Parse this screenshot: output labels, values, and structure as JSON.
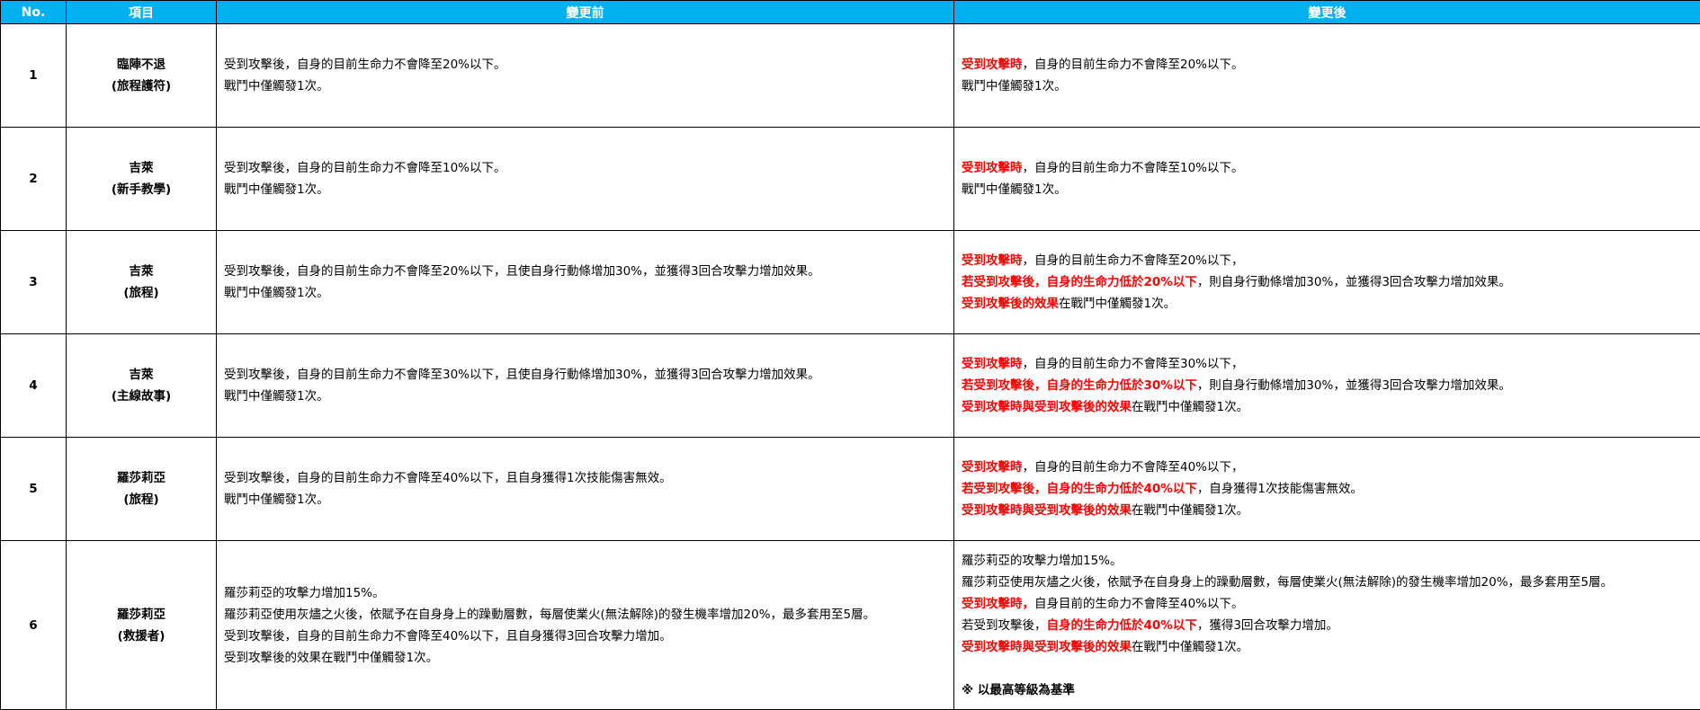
{
  "headers": {
    "no": "No.",
    "item": "項目",
    "before": "變更前",
    "after": "變更後"
  },
  "rows": [
    {
      "no": "1",
      "item": [
        "臨陣不退",
        "(旅程護符)"
      ],
      "before": [
        [
          {
            "t": "受到攻擊後，自身的目前生命力不會降至20%以下。",
            "r": false
          }
        ],
        [
          {
            "t": "戰鬥中僅觸發1次。",
            "r": false
          }
        ]
      ],
      "after": [
        [
          {
            "t": "受到攻擊時",
            "r": true
          },
          {
            "t": "，自身的目前生命力不會降至20%以下。",
            "r": false
          }
        ],
        [
          {
            "t": "戰鬥中僅觸發1次。",
            "r": false
          }
        ]
      ]
    },
    {
      "no": "2",
      "item": [
        "吉萊",
        "(新手教學)"
      ],
      "before": [
        [
          {
            "t": "受到攻擊後，自身的目前生命力不會降至10%以下。",
            "r": false
          }
        ],
        [
          {
            "t": "戰鬥中僅觸發1次。",
            "r": false
          }
        ]
      ],
      "after": [
        [
          {
            "t": "受到攻擊時",
            "r": true
          },
          {
            "t": "，自身的目前生命力不會降至10%以下。",
            "r": false
          }
        ],
        [
          {
            "t": "戰鬥中僅觸發1次。",
            "r": false
          }
        ]
      ]
    },
    {
      "no": "3",
      "item": [
        "吉萊",
        "(旅程)"
      ],
      "before": [
        [
          {
            "t": "受到攻擊後，自身的目前生命力不會降至20%以下，且使自身行動條增加30%，並獲得3回合攻擊力增加效果。",
            "r": false
          }
        ],
        [
          {
            "t": "戰鬥中僅觸發1次。",
            "r": false
          }
        ]
      ],
      "after": [
        [
          {
            "t": "受到攻擊時",
            "r": true
          },
          {
            "t": "，自身的目前生命力不會降至20%以下，",
            "r": false
          }
        ],
        [
          {
            "t": "若受到攻擊後，自身的生命力低於20%以下",
            "r": true
          },
          {
            "t": "，則自身行動條增加30%，並獲得3回合攻擊力增加效果。",
            "r": false
          }
        ],
        [
          {
            "t": "受到攻擊後的效果",
            "r": true
          },
          {
            "t": "在戰鬥中僅觸發1次。",
            "r": false
          }
        ]
      ]
    },
    {
      "no": "4",
      "item": [
        "吉萊",
        "(主線故事)"
      ],
      "before": [
        [
          {
            "t": "受到攻擊後，自身的目前生命力不會降至30%以下，且使自身行動條增加30%，並獲得3回合攻擊力增加效果。",
            "r": false
          }
        ],
        [
          {
            "t": "戰鬥中僅觸發1次。",
            "r": false
          }
        ]
      ],
      "after": [
        [
          {
            "t": "受到攻擊時",
            "r": true
          },
          {
            "t": "，自身的目前生命力不會降至30%以下，",
            "r": false
          }
        ],
        [
          {
            "t": "若受到攻擊後，自身的生命力低於30%以下",
            "r": true
          },
          {
            "t": "，則自身行動條增加30%，並獲得3回合攻擊力增加效果。",
            "r": false
          }
        ],
        [
          {
            "t": "受到攻擊時與受到攻擊後的效果",
            "r": true
          },
          {
            "t": "在戰鬥中僅觸發1次。",
            "r": false
          }
        ]
      ]
    },
    {
      "no": "5",
      "item": [
        "羅莎莉亞",
        "(旅程)"
      ],
      "before": [
        [
          {
            "t": "受到攻擊後，自身的目前生命力不會降至40%以下，且自身獲得1次技能傷害無效。",
            "r": false
          }
        ],
        [
          {
            "t": "戰鬥中僅觸發1次。",
            "r": false
          }
        ]
      ],
      "after": [
        [
          {
            "t": "受到攻擊時",
            "r": true
          },
          {
            "t": "，自身的目前生命力不會降至40%以下，",
            "r": false
          }
        ],
        [
          {
            "t": "若受到攻擊後，自身的生命力低於40%以下",
            "r": true
          },
          {
            "t": "，自身獲得1次技能傷害無效。",
            "r": false
          }
        ],
        [
          {
            "t": "受到攻擊時與受到攻擊後的效果",
            "r": true
          },
          {
            "t": "在戰鬥中僅觸發1次。",
            "r": false
          }
        ]
      ]
    },
    {
      "no": "6",
      "item": [
        "羅莎莉亞",
        "(救援者)"
      ],
      "before": [
        [
          {
            "t": "羅莎莉亞的攻擊力增加15%。",
            "r": false
          }
        ],
        [
          {
            "t": "羅莎莉亞使用灰燼之火後，依賦予在自身身上的躁動層數，每層使業火(無法解除)的發生機率增加20%，最多套用至5層。",
            "r": false
          }
        ],
        [
          {
            "t": "受到攻擊後，自身的目前生命力不會降至40%以下，且自身獲得3回合攻擊力增加。",
            "r": false
          }
        ],
        [
          {
            "t": "受到攻擊後的效果在戰鬥中僅觸發1次。",
            "r": false
          }
        ]
      ],
      "after": [
        [
          {
            "t": "羅莎莉亞的攻擊力增加15%。",
            "r": false
          }
        ],
        [
          {
            "t": "羅莎莉亞使用灰燼之火後，依賦予在自身身上的躁動層數，每層使業火(無法解除)的發生機率增加20%，最多套用至5層。",
            "r": false
          }
        ],
        [
          {
            "t": "受到攻擊時，",
            "r": true
          },
          {
            "t": "自身目前的生命力不會降至40%以下。",
            "r": false
          }
        ],
        [
          {
            "t": "若受到攻擊後，",
            "r": false
          },
          {
            "t": "自身的生命力低於40%以下",
            "r": true
          },
          {
            "t": "，獲得3回合攻擊力增加。",
            "r": false
          }
        ],
        [
          {
            "t": "受到攻擊時與受到攻擊後的效果",
            "r": true
          },
          {
            "t": "在戰鬥中僅觸發1次。",
            "r": false
          }
        ]
      ],
      "note": "※ 以最高等級為基準"
    }
  ]
}
